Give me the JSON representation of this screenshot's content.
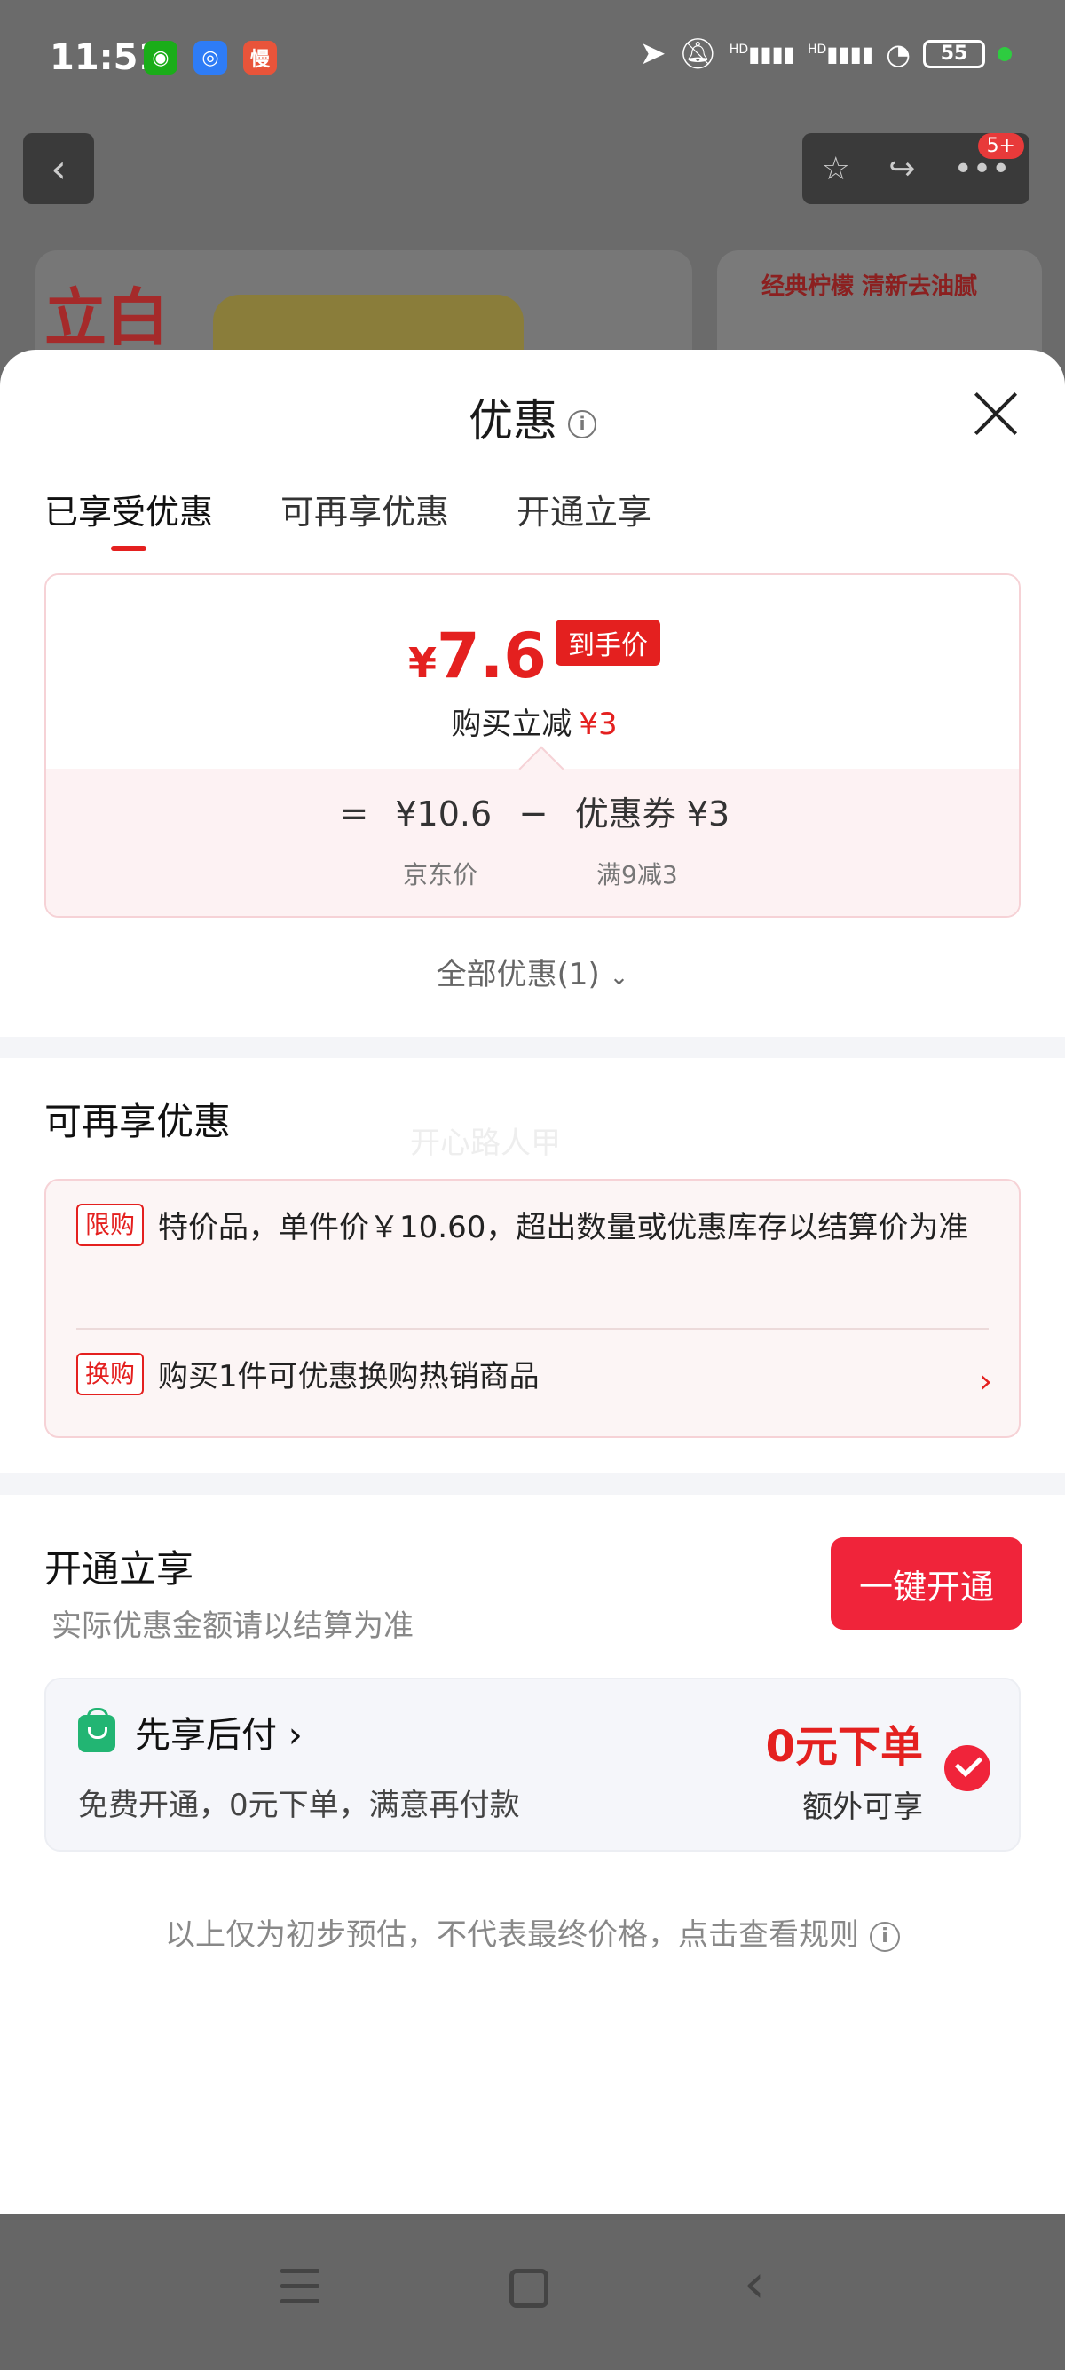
{
  "status_bar": {
    "time": "11:51",
    "apps": [
      "wechat-icon",
      "alarm-app-icon",
      "slow-app-icon"
    ],
    "battery": "55",
    "signal_labels": [
      "HD",
      "HD"
    ]
  },
  "background_page": {
    "brand_text": "立白",
    "product2_tag": "经典柠檬 清新去油腻",
    "badge": "5+"
  },
  "sheet": {
    "title": "优惠",
    "tabs": [
      {
        "label": "已享受优惠",
        "active": true
      },
      {
        "label": "可再享优惠",
        "active": false
      },
      {
        "label": "开通立享",
        "active": false
      }
    ],
    "final_price": {
      "yen": "¥",
      "value": "7.6",
      "pill": "到手价",
      "saving_label": "购买立减",
      "saving_amount": "¥3"
    },
    "formula": {
      "eq": "=",
      "jd_price": "¥10.6",
      "minus": "−",
      "coupon": "优惠券 ¥3",
      "jd_label": "京东价",
      "coupon_label": "满9减3"
    },
    "all_discounts": "全部优惠(1)",
    "more_section": {
      "title": "可再享优惠",
      "watermark": "开心路人甲",
      "items": [
        {
          "tag": "限购",
          "text": "特价品，单件价￥10.60，超出数量或优惠库存以结算价为准"
        },
        {
          "tag": "换购",
          "text": "购买1件可优惠换购热销商品"
        }
      ]
    },
    "open_section": {
      "title": "开通立享",
      "subtitle": "实际优惠金额请以结算为准",
      "button": "一键开通",
      "paylater": {
        "title": "先享后付",
        "chevron": "›",
        "desc": "免费开通，0元下单，满意再付款",
        "amount": "0元下单",
        "extra": "额外可享"
      }
    },
    "footnote": "以上仅为初步预估，不代表最终价格，点击查看规则"
  },
  "colors": {
    "accent_red": "#e4201f",
    "button_red": "#f0243a",
    "green": "#22b573"
  }
}
